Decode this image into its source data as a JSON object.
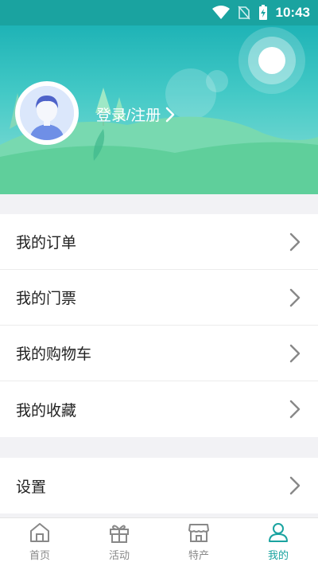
{
  "status_bar": {
    "time": "10:43"
  },
  "profile": {
    "login_label": "登录/注册"
  },
  "menu": {
    "group1": [
      {
        "label": "我的订单"
      },
      {
        "label": "我的门票"
      },
      {
        "label": "我的购物车"
      },
      {
        "label": "我的收藏"
      }
    ],
    "group2": [
      {
        "label": "设置"
      }
    ]
  },
  "tabs": [
    {
      "label": "首页",
      "icon": "home-icon",
      "active": false
    },
    {
      "label": "活动",
      "icon": "gift-icon",
      "active": false
    },
    {
      "label": "特产",
      "icon": "shop-icon",
      "active": false
    },
    {
      "label": "我的",
      "icon": "user-icon",
      "active": true
    }
  ],
  "colors": {
    "accent": "#1aa3a0",
    "header_top": "#1eb3b6",
    "hill": "#5fcf9b"
  }
}
